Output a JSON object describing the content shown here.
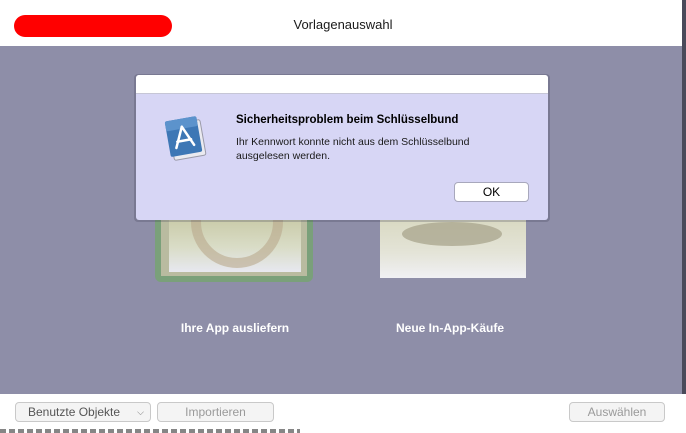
{
  "window": {
    "title": "Vorlagenauswahl"
  },
  "options": [
    {
      "label": "Ihre App ausliefern"
    },
    {
      "label": "Neue In-App-Käufe"
    }
  ],
  "alert": {
    "heading": "Sicherheitsproblem beim Schlüsselbund",
    "message": "Ihr Kennwort konnte nicht aus dem Schlüsselbund ausgelesen werden.",
    "ok_label": "OK",
    "icon": "app-store-icon"
  },
  "bottombar": {
    "objects_label": "Benutzte Objekte",
    "import_label": "Importieren",
    "select_label": "Auswählen"
  },
  "colors": {
    "content_bg": "#8e8ea8",
    "sheet_bg": "#d7d6f5",
    "redaction": "#ff0000"
  }
}
